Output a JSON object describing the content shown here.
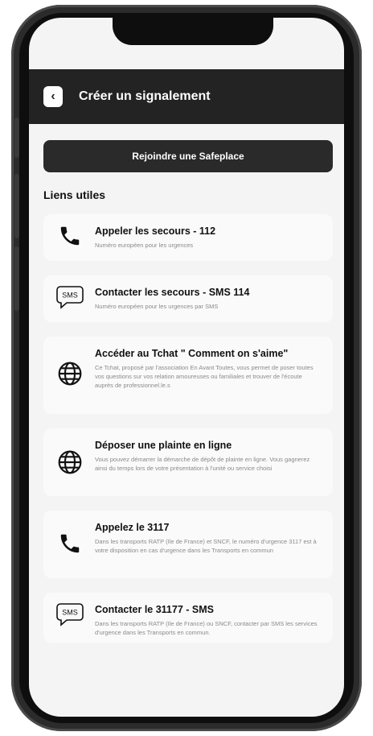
{
  "header": {
    "back_icon": "chevron-left-icon",
    "title": "Créer un signalement"
  },
  "safeplace_button": {
    "label": "Rejoindre une Safeplace"
  },
  "section": {
    "title": "Liens utiles"
  },
  "links": [
    {
      "icon": "phone-icon",
      "title": "Appeler les secours - 112",
      "description": "Numéro européen pour les urgences"
    },
    {
      "icon": "sms-icon",
      "title": "Contacter les secours - SMS 114",
      "description": "Numéro européen pour les urgences par SMS"
    },
    {
      "icon": "globe-icon",
      "title": "Accéder au Tchat \" Comment on s'aime\"",
      "description": "Ce Tchat, proposé par l'association En Avant Toutes, vous permet de poser toutes vos questions sur vos relation amoureuses ou familiales et trouver de l'écoute auprès de professionnel.le.s"
    },
    {
      "icon": "globe-icon",
      "title": "Déposer une plainte en ligne",
      "description": "Vous pouvez démarrer la démarche de dépôt de plainte en ligne. Vous gagnerez ainsi du temps lors de votre présentation à l'unité ou service choisi"
    },
    {
      "icon": "phone-icon",
      "title": "Appelez le 3117",
      "description": "Dans les transports RATP (Ile de France) et SNCF, le numéro d'urgence 3117 est à votre disposition en cas d'urgence dans les Transports en commun"
    },
    {
      "icon": "sms-icon",
      "title": "Contacter le 31177 - SMS",
      "description": "Dans les transports RATP (Ile de France) ou SNCF, contacter par SMS les services d'urgence dans les Transports en commun."
    }
  ],
  "sms_icon_text": "SMS"
}
